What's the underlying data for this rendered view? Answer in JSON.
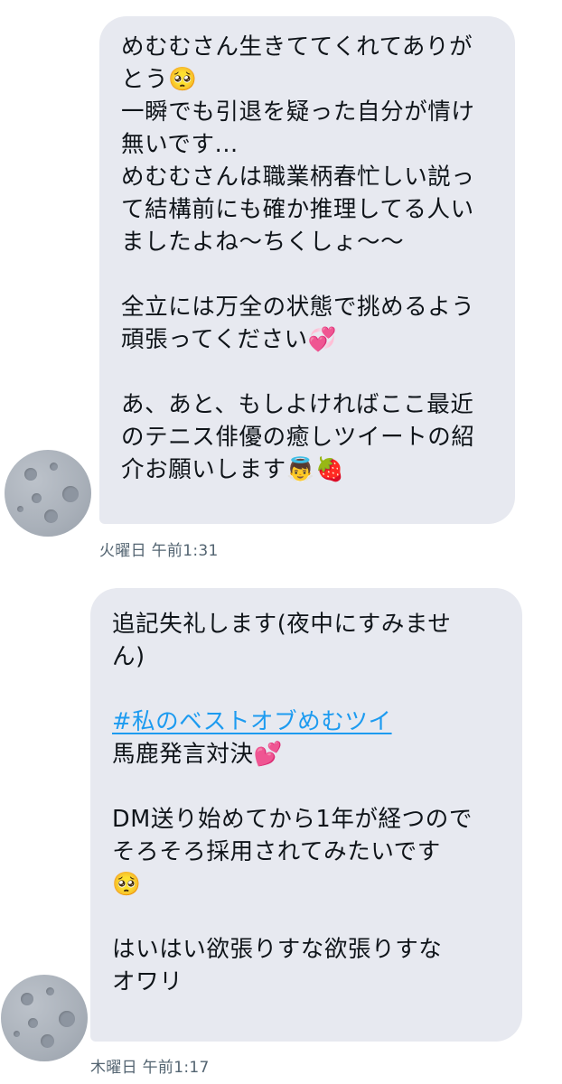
{
  "messages": [
    {
      "lines": [
        "めむむさん生きててくれてありが",
        "とう🥺",
        "一瞬でも引退を疑った自分が情け",
        "無いです...",
        "めむむさんは職業柄春忙しい説っ",
        "て結構前にも確か推理してる人い",
        "ましたよね〜ちくしょ〜〜",
        "",
        "全立には万全の状態で挑めるよう",
        "頑張ってください💞",
        "",
        "あ、あと、もしよければここ最近",
        "のテニス俳優の癒しツイートの紹",
        "介お願いします👼🍓"
      ],
      "timestamp": "火曜日 午前1:31"
    },
    {
      "line1": "追記失礼します(夜中にすみませ",
      "line2": "ん)",
      "hashtag": "#私のベストオブめむツイ",
      "line4": "馬鹿発言対決💕",
      "line5": "DM送り始めてから1年が経つので",
      "line6": "そろそろ採用されてみたいです",
      "line7": "🥺",
      "line8": "はいはい欲張りすな欲張りすな",
      "line9": "オワリ",
      "timestamp": "木曜日 午前1:17"
    }
  ],
  "colors": {
    "bubble_background": "#e7e9f0",
    "hashtag": "#1d9bf0",
    "timestamp": "#536471",
    "avatar": "#a9b0b9"
  },
  "icons": {
    "avatar": "moon-avatar"
  }
}
